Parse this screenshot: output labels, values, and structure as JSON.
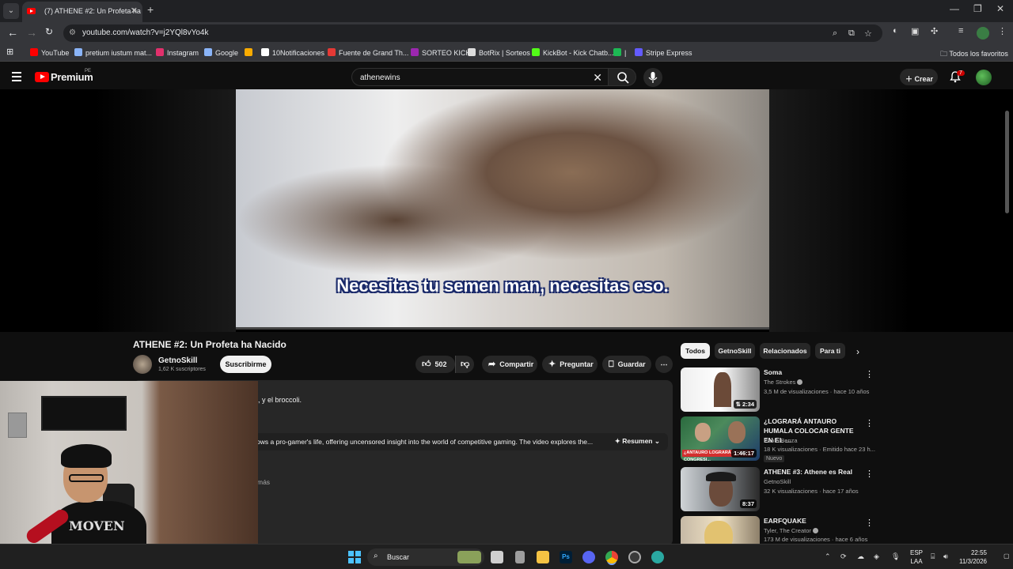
{
  "browser": {
    "tab_title": "(7) ATHENE #2: Un Profeta ha N",
    "url": "youtube.com/watch?v=j2YQl8vYo4k",
    "bookmarks": [
      {
        "label": "YouTube",
        "color": "#ff0000"
      },
      {
        "label": "pretium iustum mat...",
        "color": "#8ab4f8"
      },
      {
        "label": "Instagram",
        "color": "#e1306c"
      },
      {
        "label": "Google",
        "color": "#8ab4f8"
      },
      {
        "label": "",
        "color": "#f9ab00"
      },
      {
        "label": "10Notificaciones",
        "color": "#ffffff"
      },
      {
        "label": "Fuente de Grand Th...",
        "color": "#e53935"
      },
      {
        "label": "SORTEO KICK",
        "color": "#9c27b0"
      },
      {
        "label": "BotRix | Sorteos",
        "color": "#dddddd"
      },
      {
        "label": "KickBot - Kick Chatb...",
        "color": "#53fc18"
      },
      {
        "label": "|",
        "color": "#1db954"
      },
      {
        "label": "Stripe Express",
        "color": "#635bff"
      }
    ],
    "all_bookmarks": "Todos los favoritos"
  },
  "youtube": {
    "brand": "Premium",
    "brand_region": "PE",
    "search_value": "athenewins",
    "create_label": "Crear",
    "notification_count": "7"
  },
  "video": {
    "caption": "Necesitas tu semen man, necesitas eso.",
    "title": "ATHENE #2: Un Profeta ha Nacido",
    "channel": "GetnoSkill",
    "subscribers": "1,62 K suscriptores",
    "subscribe_label": "Suscribirme",
    "likes": "502",
    "share_label": "Compartir",
    "ask_label": "Preguntar",
    "save_label": "Guardar"
  },
  "description": {
    "line1": "l, y el broccoli.",
    "summary": "ows a pro-gamer's life, offering uncensored insight into the world of competitive gaming. The video explores the...",
    "summary_label": "Resumen",
    "more": "más"
  },
  "chips": [
    "Todos",
    "GetnoSkill",
    "Relacionados",
    "Para ti"
  ],
  "recommendations": [
    {
      "title": "Soma",
      "channel": "The Strokes",
      "verified": true,
      "meta": "3,5 M de visualizaciones · hace 10 años",
      "duration": "2:34",
      "badge": ""
    },
    {
      "title": "¿LOGRARÁ ANTAURO HUMALA COLOCAR GENTE EN EL ...",
      "channel": "Paolo Benza",
      "verified": false,
      "meta": "18 K visualizaciones · Emitido hace 23 h...",
      "duration": "1:46:17",
      "badge": "Nuevo"
    },
    {
      "title": "ATHENE #3: Athene es Real",
      "channel": "GetnoSkill",
      "verified": false,
      "meta": "32 K visualizaciones · hace 17 años",
      "duration": "8:37",
      "badge": ""
    },
    {
      "title": "EARFQUAKE",
      "channel": "Tyler, The Creator",
      "verified": true,
      "meta": "173 M de visualizaciones · hace 6 años",
      "duration": "",
      "badge": ""
    }
  ],
  "webcam": {
    "shirt_text": "MOVEN"
  },
  "taskbar": {
    "search_label": "Buscar",
    "language": "ESP",
    "layout": "LAA",
    "time": "22:55",
    "date": "11/3/2026"
  }
}
